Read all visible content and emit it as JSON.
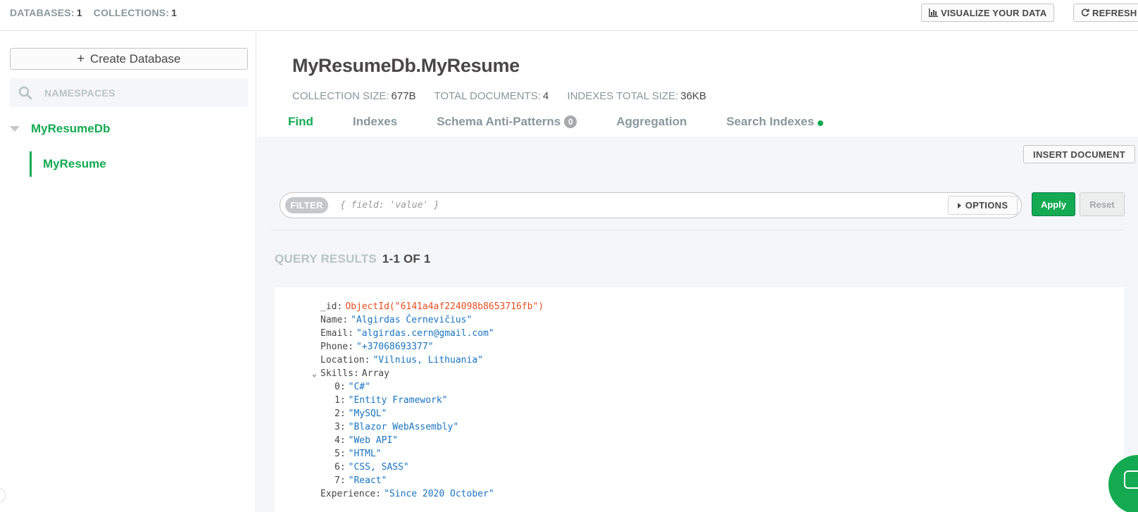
{
  "topbar": {
    "databases_label": "DATABASES:",
    "databases_count": "1",
    "collections_label": "COLLECTIONS:",
    "collections_count": "1",
    "visualize_label": "VISUALIZE YOUR DATA",
    "refresh_label": "REFRESH"
  },
  "sidebar": {
    "create_db_label": "Create Database",
    "search_placeholder": "NAMESPACES",
    "database_name": "MyResumeDb",
    "collection_name": "MyResume"
  },
  "header": {
    "title": "MyResumeDb.MyResume",
    "stats": [
      {
        "label": "COLLECTION SIZE:",
        "value": "677B"
      },
      {
        "label": "TOTAL DOCUMENTS:",
        "value": "4"
      },
      {
        "label": "INDEXES TOTAL SIZE:",
        "value": "36KB"
      }
    ],
    "tabs": [
      {
        "label": "Find",
        "active": true
      },
      {
        "label": "Indexes"
      },
      {
        "label": "Schema Anti-Patterns",
        "badge": "0"
      },
      {
        "label": "Aggregation"
      },
      {
        "label": "Search Indexes"
      }
    ]
  },
  "toolbar": {
    "insert_label": "INSERT DOCUMENT",
    "filter_label": "FILTER",
    "filter_placeholder": "{ field: 'value' }",
    "options_label": "OPTIONS",
    "apply_label": "Apply",
    "reset_label": "Reset"
  },
  "results": {
    "label": "QUERY RESULTS",
    "range": "1-1 OF 1"
  },
  "document": {
    "id_key": "_id",
    "id_value": "ObjectId(\"6141a4af224098b8653716fb\")",
    "fields": [
      {
        "key": "Name",
        "value": "\"Algirdas Černevičius\""
      },
      {
        "key": "Email",
        "value": "\"algirdas.cern@gmail.com\""
      },
      {
        "key": "Phone",
        "value": "\"+37068693377\""
      },
      {
        "key": "Location",
        "value": "\"Vilnius, Lithuania\""
      }
    ],
    "skills_key": "Skills",
    "skills_type": "Array",
    "skills": [
      {
        "index": "0",
        "value": "\"C#\""
      },
      {
        "index": "1",
        "value": "\"Entity Framework\""
      },
      {
        "index": "2",
        "value": "\"MySQL\""
      },
      {
        "index": "3",
        "value": "\"Blazor WebAssembly\""
      },
      {
        "index": "4",
        "value": "\"Web API\""
      },
      {
        "index": "5",
        "value": "\"HTML\""
      },
      {
        "index": "6",
        "value": "\"CSS, SASS\""
      },
      {
        "index": "7",
        "value": "\"React\""
      }
    ],
    "experience_key": "Experience",
    "experience_value": "\"Since 2020 October\""
  },
  "colors": {
    "accent": "#13aa52",
    "string_value": "#1a74c2",
    "objectid_value": "#e64e22"
  },
  "icons": [
    "bar-chart-icon",
    "refresh-icon",
    "plus-icon",
    "search-icon",
    "caret-down-icon",
    "caret-right-icon",
    "chat-icon"
  ]
}
